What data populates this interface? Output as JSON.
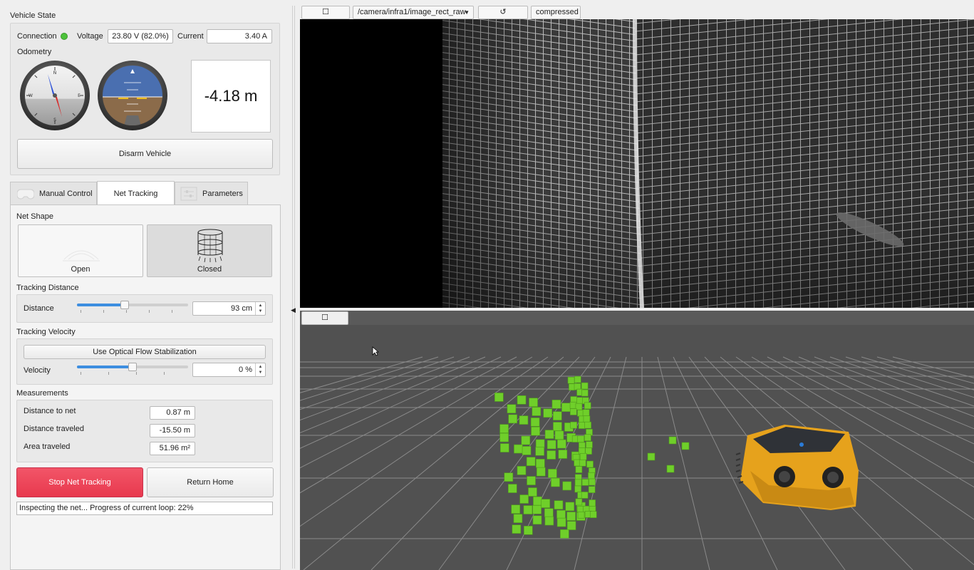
{
  "vehicle_state": {
    "title": "Vehicle State",
    "connection_label": "Connection",
    "connection_color": "#4cc23a",
    "voltage_label": "Voltage",
    "voltage_value": "23.80 V  (82.0%)",
    "current_label": "Current",
    "current_value": "3.40 A",
    "odometry_label": "Odometry",
    "odometry_value": "-4.18 m",
    "disarm_button": "Disarm Vehicle"
  },
  "tabs": [
    {
      "label": "Manual Control",
      "icon": "gamepad-icon",
      "active": false
    },
    {
      "label": "Net Tracking",
      "icon": "",
      "active": true
    },
    {
      "label": "Parameters",
      "icon": "sliders-icon",
      "active": false
    }
  ],
  "net_tracking": {
    "net_shape_label": "Net Shape",
    "shape_open": "Open",
    "shape_closed": "Closed",
    "selected_shape": "Closed",
    "tracking_distance_label": "Tracking Distance",
    "distance_label": "Distance",
    "distance_value": "93 cm",
    "distance_fraction": 0.43,
    "tracking_velocity_label": "Tracking Velocity",
    "optical_flow_button": "Use Optical Flow Stabilization",
    "velocity_label": "Velocity",
    "velocity_value": "0 %",
    "velocity_fraction": 0.5,
    "measurements_label": "Measurements",
    "distance_to_net_label": "Distance to net",
    "distance_to_net_value": "0.87 m",
    "distance_traveled_label": "Distance traveled",
    "distance_traveled_value": "-15.50 m",
    "area_traveled_label": "Area traveled",
    "area_traveled_value": "51.96 m²",
    "stop_button": "Stop Net Tracking",
    "return_button": "Return Home",
    "status": "Inspecting the net... Progress of current loop: 22%"
  },
  "camera_panel": {
    "topic": "/camera/infra1/image_rect_raw",
    "refresh_icon": "↺",
    "transport": "compressed"
  },
  "colors": {
    "accent": "#3d8ee0",
    "stop": "#e8394e",
    "rviz_bg": "#515151",
    "voxel": "#6fcf2a",
    "robot": "#e6a21c"
  }
}
